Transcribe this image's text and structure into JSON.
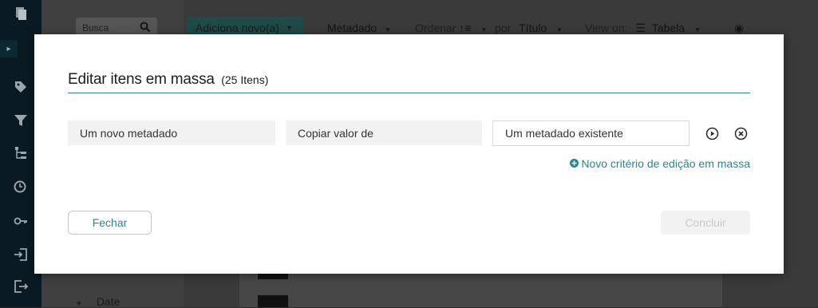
{
  "background": {
    "search_placeholder": "Busca",
    "add_new_label": "Adiciona novo(a)",
    "metadata_label": "Metadado",
    "order_label": "Ordenar",
    "by_label": "por",
    "sort_field": "Título",
    "view_on_label": "View on:",
    "view_mode": "Tabela",
    "filter_date_label": "Date"
  },
  "modal": {
    "title": "Editar itens em massa",
    "count": "(25 Itens)",
    "criterion": {
      "target_metadata": "Um novo metadado",
      "operation": "Copiar valor de",
      "source_metadata": "Um metadado existente"
    },
    "add_criterion_label": "Novo critério de edição em massa",
    "close_label": "Fechar",
    "conclude_label": "Concluir"
  },
  "colors": {
    "accent": "#298596",
    "field_bg": "#f2f2f2",
    "overlay_rail": "#0a1a22"
  }
}
